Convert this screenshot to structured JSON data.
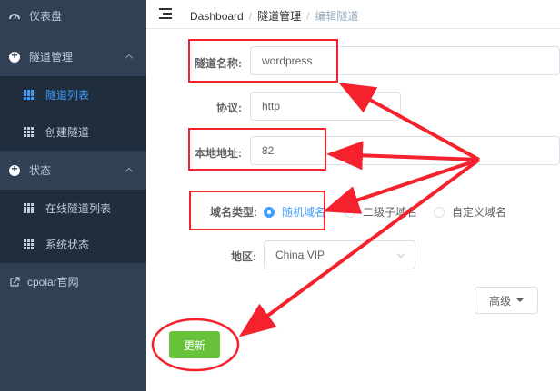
{
  "sidebar": {
    "items": [
      {
        "label": "仪表盘",
        "icon": "dashboard-icon"
      },
      {
        "label": "隧道管理",
        "icon": "plus-circle-icon"
      },
      {
        "label": "隧道列表",
        "icon": "grid-icon",
        "active": true
      },
      {
        "label": "创建隧道",
        "icon": "grid-icon"
      },
      {
        "label": "状态",
        "icon": "plus-circle-icon"
      },
      {
        "label": "在线隧道列表",
        "icon": "grid-icon"
      },
      {
        "label": "系统状态",
        "icon": "grid-icon"
      },
      {
        "label": "cpolar官网",
        "icon": "external-link-icon"
      }
    ]
  },
  "breadcrumb": [
    "Dashboard",
    "隧道管理",
    "编辑隧道"
  ],
  "form": {
    "name_label": "隧道名称:",
    "name_value": "wordpress",
    "protocol_label": "协议:",
    "protocol_value": "http",
    "local_label": "本地地址:",
    "local_value": "82",
    "domain_type_label": "域名类型:",
    "domain_options": [
      "随机域名",
      "二级子域名",
      "自定义域名"
    ],
    "domain_selected": "随机域名",
    "region_label": "地区:",
    "region_value": "China VIP"
  },
  "advanced_label": "高级",
  "update_label": "更新",
  "colors": {
    "sidebar_bg": "#304156",
    "submenu_bg": "#1f2d3d",
    "accent": "#409eff",
    "success": "#67c23a",
    "annotation": "#f5222d"
  }
}
